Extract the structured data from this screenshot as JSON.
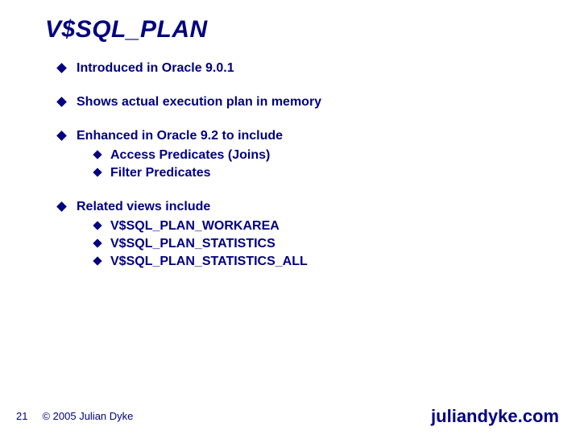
{
  "title": "V$SQL_PLAN",
  "bullets": [
    {
      "text": "Introduced in Oracle 9.0.1",
      "subs": []
    },
    {
      "text": "Shows actual execution plan in memory",
      "subs": []
    },
    {
      "text": "Enhanced in Oracle 9.2 to include",
      "subs": [
        "Access Predicates (Joins)",
        "Filter Predicates"
      ]
    },
    {
      "text": "Related views include",
      "subs": [
        "V$SQL_PLAN_WORKAREA",
        "V$SQL_PLAN_STATISTICS",
        "V$SQL_PLAN_STATISTICS_ALL"
      ]
    }
  ],
  "footer": {
    "page": "21",
    "copyright": "© 2005 Julian Dyke",
    "site": "juliandyke.com"
  }
}
